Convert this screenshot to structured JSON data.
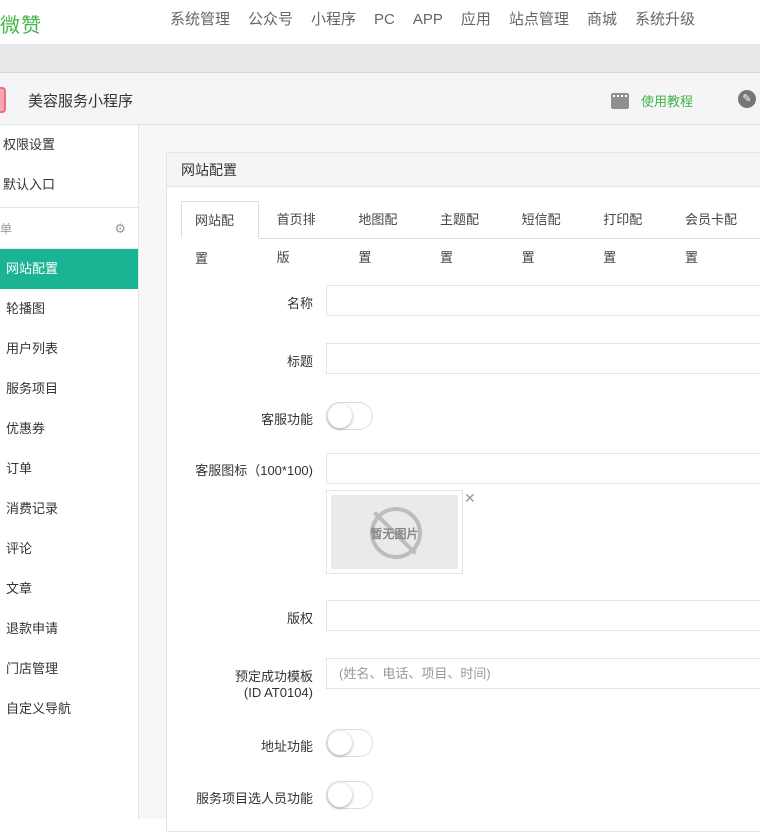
{
  "topnav": {
    "logo": "微赞",
    "menu": [
      "系统管理",
      "公众号",
      "小程序",
      "PC",
      "APP",
      "应用",
      "站点管理",
      "商城",
      "系统升级"
    ]
  },
  "account": {
    "name": "美容服务小程序",
    "tutorial_label": "使用教程"
  },
  "sidebar": {
    "top_items": [
      "权限设置",
      "默认入口"
    ],
    "section_label": "单",
    "items": [
      "网站配置",
      "轮播图",
      "用户列表",
      "服务项目",
      "优惠券",
      "订单",
      "消费记录",
      "评论",
      "文章",
      "退款申请",
      "门店管理",
      "自定义导航"
    ],
    "active_index": 0
  },
  "panel": {
    "title": "网站配置",
    "tabs": [
      "网站配置",
      "首页排版",
      "地图配置",
      "主题配置",
      "短信配置",
      "打印配置",
      "会员卡配置"
    ],
    "active_tab": 0
  },
  "form": {
    "name_label": "名称",
    "name_value": "",
    "title_label": "标题",
    "title_value": "",
    "service_label": "客服功能",
    "service_on": false,
    "service_icon_label": "客服图标（100*100)",
    "service_icon_value": "",
    "no_image_text": "暂无图片",
    "copyright_label": "版权",
    "copyright_value": "",
    "template_label_line1": "预定成功模板",
    "template_label_line2": "(ID AT0104)",
    "template_placeholder": "(姓名、电话、项目、时间)",
    "address_label": "地址功能",
    "address_on": false,
    "staff_label": "服务项目选人员功能",
    "staff_on": false
  },
  "colors": {
    "accent": "#1ab394",
    "brand_green": "#44b549"
  }
}
